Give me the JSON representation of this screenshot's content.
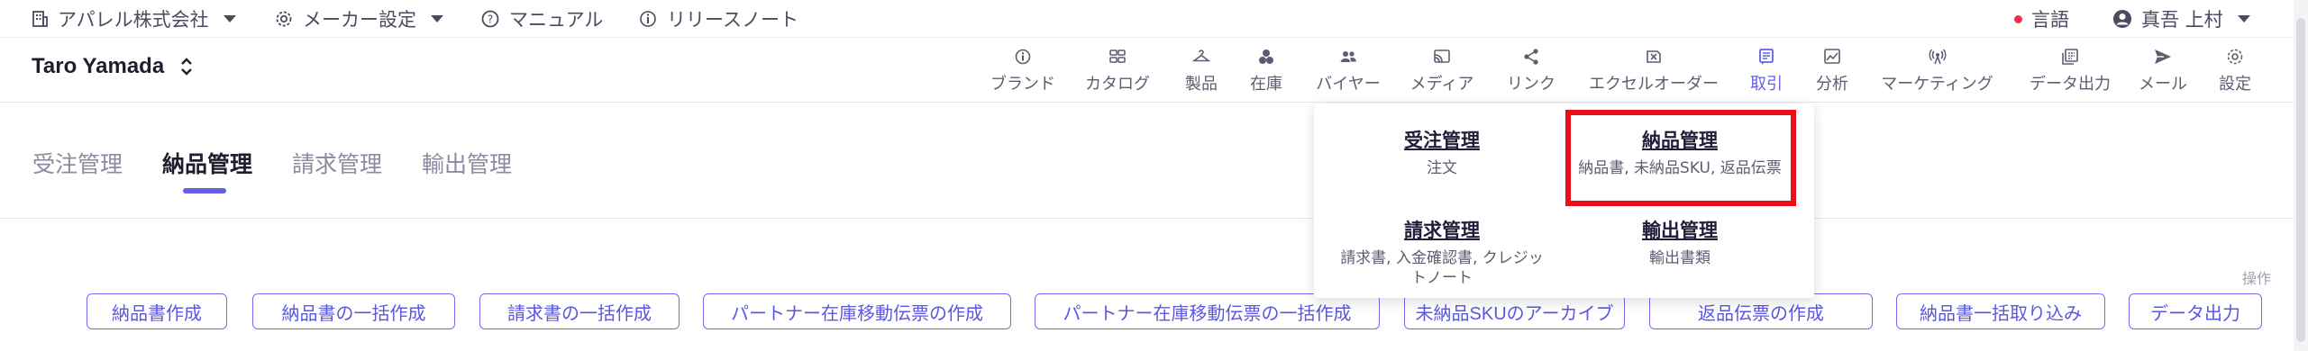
{
  "topbar": {
    "company": "アパレル株式会社",
    "maker_settings": "メーカー設定",
    "manual": "マニュアル",
    "release_notes": "リリースノート",
    "language": "言語",
    "user_name": "真吾 上村"
  },
  "navbar": {
    "account_name": "Taro Yamada",
    "items": [
      {
        "label": "ブランド",
        "icon": "brand-icon"
      },
      {
        "label": "カタログ",
        "icon": "catalog-icon"
      },
      {
        "label": "製品",
        "icon": "hanger-icon"
      },
      {
        "label": "在庫",
        "icon": "inventory-icon"
      },
      {
        "label": "バイヤー",
        "icon": "buyers-icon"
      },
      {
        "label": "メディア",
        "icon": "media-icon"
      },
      {
        "label": "リンク",
        "icon": "share-icon"
      },
      {
        "label": "エクセルオーダー",
        "icon": "excel-order-icon"
      },
      {
        "label": "取引",
        "icon": "transactions-icon"
      },
      {
        "label": "分析",
        "icon": "analytics-icon"
      },
      {
        "label": "マーケティング",
        "icon": "marketing-icon"
      },
      {
        "label": "データ出力",
        "icon": "data-export-icon"
      },
      {
        "label": "メール",
        "icon": "mail-icon"
      },
      {
        "label": "設定",
        "icon": "settings-icon"
      }
    ],
    "active_index": 8
  },
  "tabs": [
    "受注管理",
    "納品管理",
    "請求管理",
    "輸出管理"
  ],
  "active_tab": "納品管理",
  "operations_label": "操作",
  "buttons": [
    "納品書作成",
    "納品書の一括作成",
    "請求書の一括作成",
    "パートナー在庫移動伝票の作成",
    "パートナー在庫移動伝票の一括作成",
    "未納品SKUのアーカイブ",
    "返品伝票の作成",
    "納品書一括取り込み",
    "データ出力"
  ],
  "dropdown": {
    "items": [
      {
        "title": "受注管理",
        "desc": "注文"
      },
      {
        "title": "納品管理",
        "desc": "納品書, 未納品SKU, 返品伝票"
      },
      {
        "title": "請求管理",
        "desc": "請求書, 入金確認書, クレジットノート"
      },
      {
        "title": "輸出管理",
        "desc": "輸出書類"
      }
    ]
  },
  "colors": {
    "accent": "#6360e6",
    "highlight": "#e8101a",
    "notification_dot": "#e8344a"
  }
}
